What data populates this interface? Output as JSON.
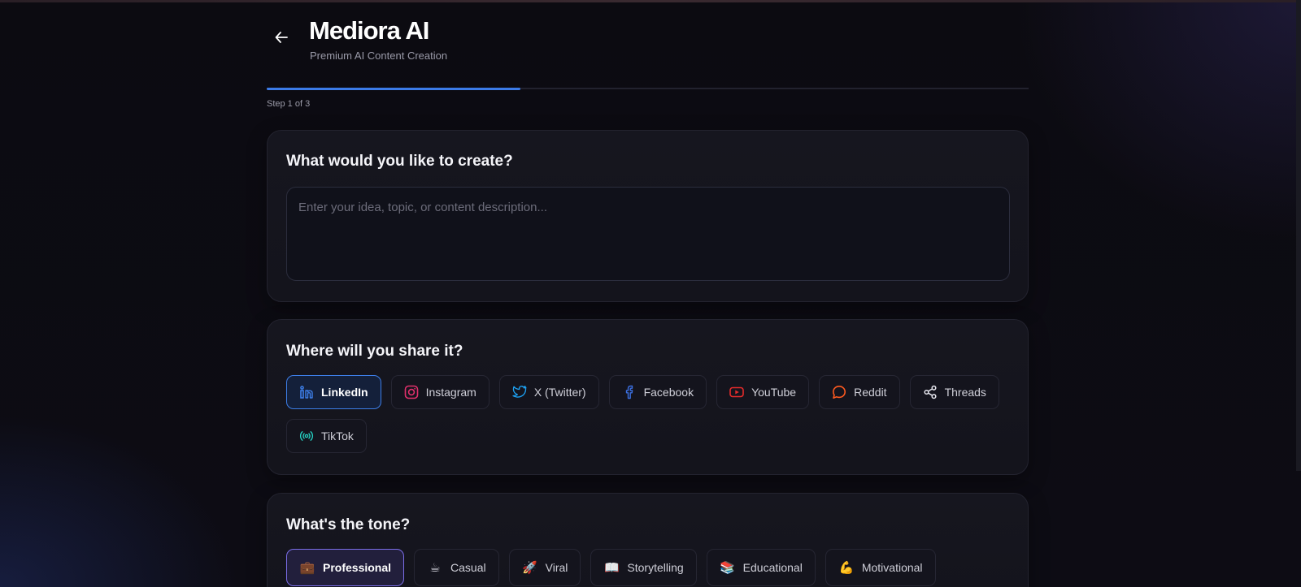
{
  "header": {
    "title": "Mediora AI",
    "subtitle": "Premium AI Content Creation",
    "back_icon": "arrow-left-icon"
  },
  "progress": {
    "fraction": 0.3333,
    "step_label": "Step 1 of 3",
    "color": "#3c7be8"
  },
  "create": {
    "heading": "What would you like to create?",
    "input_value": "",
    "input_placeholder": "Enter your idea, topic, or content description..."
  },
  "share": {
    "heading": "Where will you share it?",
    "platforms": [
      {
        "label": "LinkedIn",
        "icon": "linkedin-icon",
        "color": "#3d7ee8",
        "selected": true
      },
      {
        "label": "Instagram",
        "icon": "instagram-icon",
        "color": "#e1306c",
        "selected": false
      },
      {
        "label": "X (Twitter)",
        "icon": "twitter-icon",
        "color": "#1da1f2",
        "selected": false
      },
      {
        "label": "Facebook",
        "icon": "facebook-icon",
        "color": "#3b6fe0",
        "selected": false
      },
      {
        "label": "YouTube",
        "icon": "youtube-icon",
        "color": "#e62b2b",
        "selected": false
      },
      {
        "label": "Reddit",
        "icon": "reddit-icon",
        "color": "#ff5a1f",
        "selected": false
      },
      {
        "label": "Threads",
        "icon": "share-icon",
        "color": "#e6e6ee",
        "selected": false
      },
      {
        "label": "TikTok",
        "icon": "broadcast-icon",
        "color": "#25d3c4",
        "selected": false
      }
    ]
  },
  "tone": {
    "heading": "What's the tone?",
    "options": [
      {
        "label": "Professional",
        "icon": "briefcase-icon",
        "emoji": "💼",
        "selected": true
      },
      {
        "label": "Casual",
        "icon": "coffee-icon",
        "emoji": "☕",
        "selected": false
      },
      {
        "label": "Viral",
        "icon": "rocket-icon",
        "emoji": "🚀",
        "selected": false
      },
      {
        "label": "Storytelling",
        "icon": "book-icon",
        "emoji": "📖",
        "selected": false
      },
      {
        "label": "Educational",
        "icon": "books-icon",
        "emoji": "📚",
        "selected": false
      },
      {
        "label": "Motivational",
        "icon": "flexed-biceps-icon",
        "emoji": "💪",
        "selected": false
      }
    ],
    "accent": "#7b6ee8"
  }
}
